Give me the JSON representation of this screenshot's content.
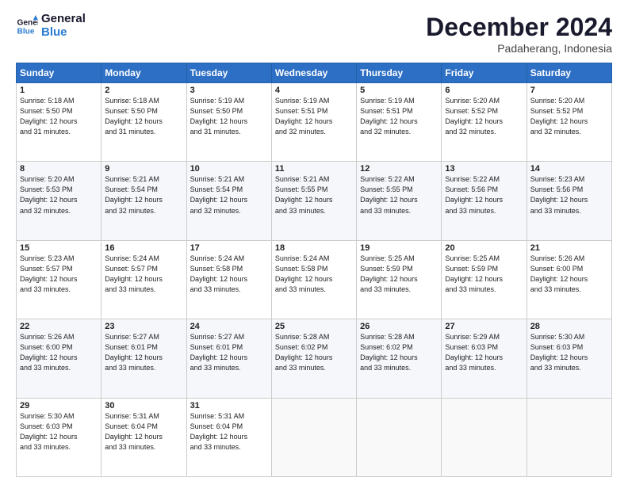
{
  "header": {
    "logo_line1": "General",
    "logo_line2": "Blue",
    "month": "December 2024",
    "location": "Padaherang, Indonesia"
  },
  "weekdays": [
    "Sunday",
    "Monday",
    "Tuesday",
    "Wednesday",
    "Thursday",
    "Friday",
    "Saturday"
  ],
  "weeks": [
    [
      {
        "day": "1",
        "sunrise": "5:18 AM",
        "sunset": "5:50 PM",
        "daylight": "12 hours and 31 minutes."
      },
      {
        "day": "2",
        "sunrise": "5:18 AM",
        "sunset": "5:50 PM",
        "daylight": "12 hours and 31 minutes."
      },
      {
        "day": "3",
        "sunrise": "5:19 AM",
        "sunset": "5:50 PM",
        "daylight": "12 hours and 31 minutes."
      },
      {
        "day": "4",
        "sunrise": "5:19 AM",
        "sunset": "5:51 PM",
        "daylight": "12 hours and 32 minutes."
      },
      {
        "day": "5",
        "sunrise": "5:19 AM",
        "sunset": "5:51 PM",
        "daylight": "12 hours and 32 minutes."
      },
      {
        "day": "6",
        "sunrise": "5:20 AM",
        "sunset": "5:52 PM",
        "daylight": "12 hours and 32 minutes."
      },
      {
        "day": "7",
        "sunrise": "5:20 AM",
        "sunset": "5:52 PM",
        "daylight": "12 hours and 32 minutes."
      }
    ],
    [
      {
        "day": "8",
        "sunrise": "5:20 AM",
        "sunset": "5:53 PM",
        "daylight": "12 hours and 32 minutes."
      },
      {
        "day": "9",
        "sunrise": "5:21 AM",
        "sunset": "5:54 PM",
        "daylight": "12 hours and 32 minutes."
      },
      {
        "day": "10",
        "sunrise": "5:21 AM",
        "sunset": "5:54 PM",
        "daylight": "12 hours and 32 minutes."
      },
      {
        "day": "11",
        "sunrise": "5:21 AM",
        "sunset": "5:55 PM",
        "daylight": "12 hours and 33 minutes."
      },
      {
        "day": "12",
        "sunrise": "5:22 AM",
        "sunset": "5:55 PM",
        "daylight": "12 hours and 33 minutes."
      },
      {
        "day": "13",
        "sunrise": "5:22 AM",
        "sunset": "5:56 PM",
        "daylight": "12 hours and 33 minutes."
      },
      {
        "day": "14",
        "sunrise": "5:23 AM",
        "sunset": "5:56 PM",
        "daylight": "12 hours and 33 minutes."
      }
    ],
    [
      {
        "day": "15",
        "sunrise": "5:23 AM",
        "sunset": "5:57 PM",
        "daylight": "12 hours and 33 minutes."
      },
      {
        "day": "16",
        "sunrise": "5:24 AM",
        "sunset": "5:57 PM",
        "daylight": "12 hours and 33 minutes."
      },
      {
        "day": "17",
        "sunrise": "5:24 AM",
        "sunset": "5:58 PM",
        "daylight": "12 hours and 33 minutes."
      },
      {
        "day": "18",
        "sunrise": "5:24 AM",
        "sunset": "5:58 PM",
        "daylight": "12 hours and 33 minutes."
      },
      {
        "day": "19",
        "sunrise": "5:25 AM",
        "sunset": "5:59 PM",
        "daylight": "12 hours and 33 minutes."
      },
      {
        "day": "20",
        "sunrise": "5:25 AM",
        "sunset": "5:59 PM",
        "daylight": "12 hours and 33 minutes."
      },
      {
        "day": "21",
        "sunrise": "5:26 AM",
        "sunset": "6:00 PM",
        "daylight": "12 hours and 33 minutes."
      }
    ],
    [
      {
        "day": "22",
        "sunrise": "5:26 AM",
        "sunset": "6:00 PM",
        "daylight": "12 hours and 33 minutes."
      },
      {
        "day": "23",
        "sunrise": "5:27 AM",
        "sunset": "6:01 PM",
        "daylight": "12 hours and 33 minutes."
      },
      {
        "day": "24",
        "sunrise": "5:27 AM",
        "sunset": "6:01 PM",
        "daylight": "12 hours and 33 minutes."
      },
      {
        "day": "25",
        "sunrise": "5:28 AM",
        "sunset": "6:02 PM",
        "daylight": "12 hours and 33 minutes."
      },
      {
        "day": "26",
        "sunrise": "5:28 AM",
        "sunset": "6:02 PM",
        "daylight": "12 hours and 33 minutes."
      },
      {
        "day": "27",
        "sunrise": "5:29 AM",
        "sunset": "6:03 PM",
        "daylight": "12 hours and 33 minutes."
      },
      {
        "day": "28",
        "sunrise": "5:30 AM",
        "sunset": "6:03 PM",
        "daylight": "12 hours and 33 minutes."
      }
    ],
    [
      {
        "day": "29",
        "sunrise": "5:30 AM",
        "sunset": "6:03 PM",
        "daylight": "12 hours and 33 minutes."
      },
      {
        "day": "30",
        "sunrise": "5:31 AM",
        "sunset": "6:04 PM",
        "daylight": "12 hours and 33 minutes."
      },
      {
        "day": "31",
        "sunrise": "5:31 AM",
        "sunset": "6:04 PM",
        "daylight": "12 hours and 33 minutes."
      },
      null,
      null,
      null,
      null
    ]
  ]
}
